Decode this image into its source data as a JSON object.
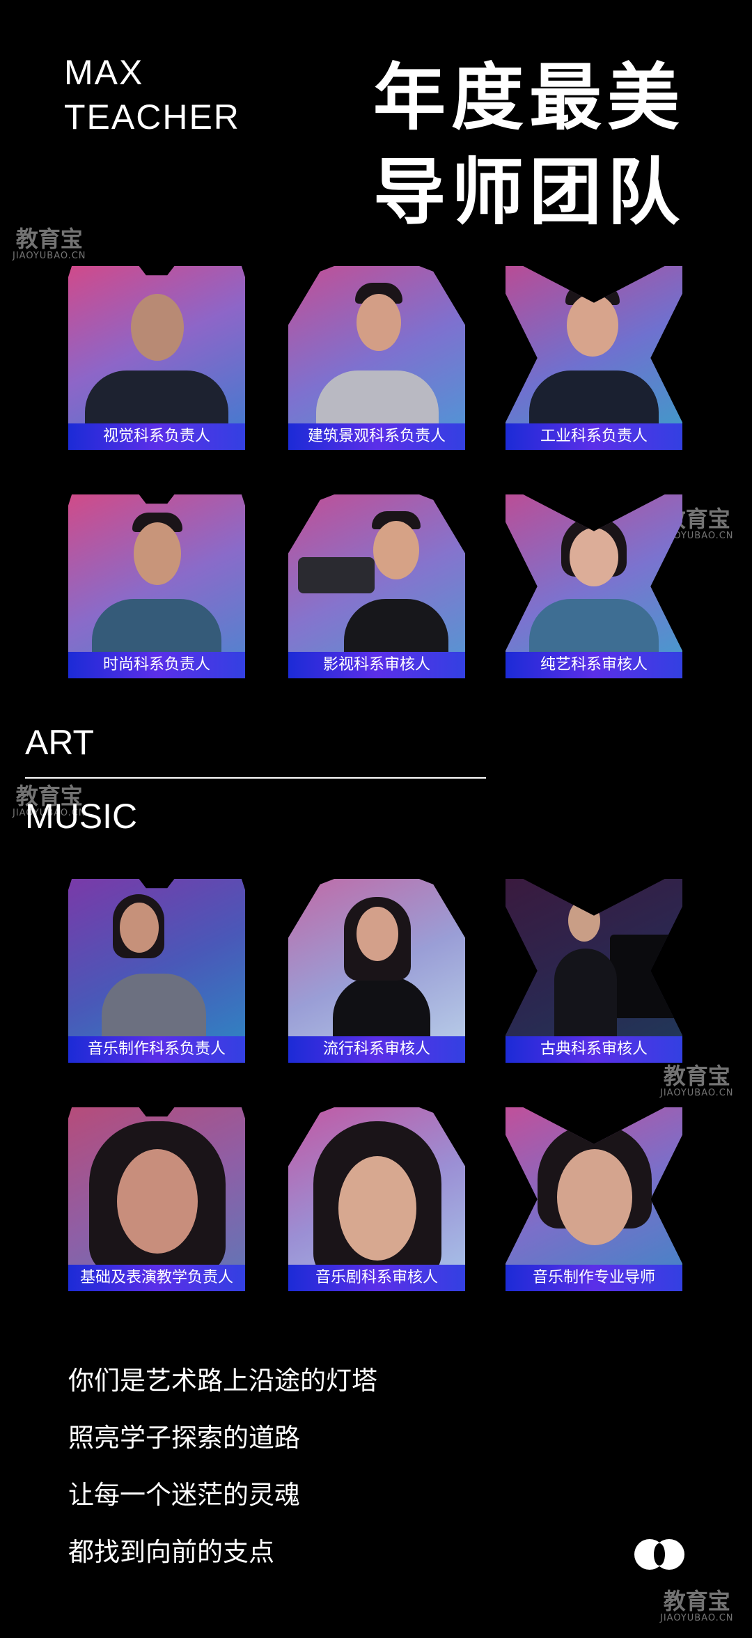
{
  "header": {
    "brand_line1": "MAX",
    "brand_line2": "TEACHER",
    "headline_line1": "年度最美",
    "headline_line2": "导师团队"
  },
  "watermark": {
    "cn": "教育宝",
    "en": "JIAOYUBAO.CN"
  },
  "art": {
    "label": "ART",
    "teachers": [
      {
        "role": "视觉科系负责人"
      },
      {
        "role": "建筑景观科系负责人"
      },
      {
        "role": "工业科系负责人"
      },
      {
        "role": "时尚科系负责人"
      },
      {
        "role": "影视科系审核人"
      },
      {
        "role": "纯艺科系审核人"
      }
    ]
  },
  "music": {
    "label": "MUSIC",
    "teachers": [
      {
        "role": "音乐制作科系负责人"
      },
      {
        "role": "流行科系审核人"
      },
      {
        "role": "古典科系审核人"
      },
      {
        "role": "基础及表演教学负责人"
      },
      {
        "role": "音乐剧科系审核人"
      },
      {
        "role": "音乐制作专业导师"
      }
    ]
  },
  "poem": {
    "line1": "你们是艺术路上沿途的灯塔",
    "line2": "照亮学子探索的道路",
    "line3": "让每一个迷茫的灵魂",
    "line4": "都找到向前的支点"
  }
}
